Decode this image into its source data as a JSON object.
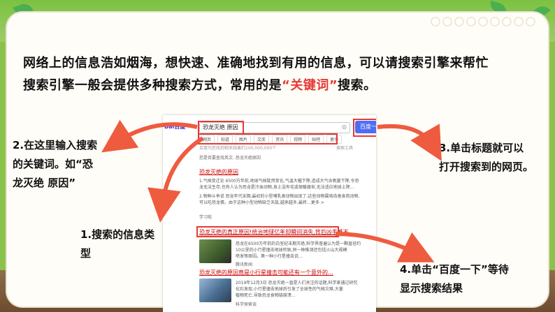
{
  "intro": {
    "line1": "网络上的信息浩如烟海，想快速、准确地找到有用的信息，可以请搜索引擎来帮忙",
    "line2_pre": "搜索引擎一般会提供多种搜索方式，常用的是",
    "line2_hl": "“关键词”",
    "line2_post": "搜索。"
  },
  "annotations": {
    "a2": [
      "2.在这里输入搜索",
      "的关键词。如“恐",
      "龙灭绝 原因”"
    ],
    "a3": [
      "3.单击标题就可以",
      "打开搜索到的网页。"
    ],
    "a1": [
      "1.搜索的信息类",
      "型"
    ],
    "a4": [
      "4.单击“百度一下”等待",
      "显示搜索结果"
    ]
  },
  "browser": {
    "logo": "Bai百度",
    "query": "恐龙灭绝 原因",
    "camera": "◎",
    "search_button": "百度一下",
    "tabs": [
      "网页",
      "知道",
      "图片",
      "文库",
      "资讯",
      "视频",
      "贴吧",
      "更多"
    ],
    "result_count": "百度为您找到相关结果约100,000,000个",
    "tools": "搜索工具",
    "suggest": "您是否要查找英文: 恐龙灭绝原因",
    "r1_title": "恐龙灭绝的原因",
    "r1_lines": [
      "1.气候变迁论 6500万年前,地球气候陡然变化,气温大幅下降,造成大气含氧量下降,令恐",
      "龙无法生存,也有人认为恐龙是冷血动物,身上没有毛或保暖器官,无法适应地球上降…",
      "2.物种斗争说 恐龙年代末期,最初的小型哺乳类动物出现了,这些动物属啮齿类食肉动物,",
      "可以吃恐龙蛋。由于这种小型动物缺乏天敌,越来越多,最终…更多 >"
    ],
    "r1_src": "学习啦",
    "r2_title": "恐龙灭绝的真正原因!统治地球亿年却瞬间消失,背后凶手难不…",
    "r2_lines": [
      "恐龙在6500万年前的白垩纪末期灭绝,科学界普遍认为是一颗直径约",
      "10公里的小行星撞击地球所致,同一种推测还包括火山大规模",
      "喷发等原因。第一种小行星撞击说…"
    ],
    "r2_src": "腾讯新闻",
    "r3_title": "恐龙灭绝的原因竟是小行星撞击可能还有一个意外的…",
    "r3_lines": [
      "2019年12月3日 恐龙灭绝一直是人们关注的话题,科学家通过研究",
      "化石发现,小行星撞击地球后引发了全球性的气候灾难,大量",
      "植物死亡,导致恐龙食物链崩溃…"
    ],
    "r3_src": "科学探索谈"
  },
  "colors": {
    "accent_red": "#e53935",
    "arrow_red": "#ef5b3f",
    "baidu_blue": "#4e6ef2"
  }
}
